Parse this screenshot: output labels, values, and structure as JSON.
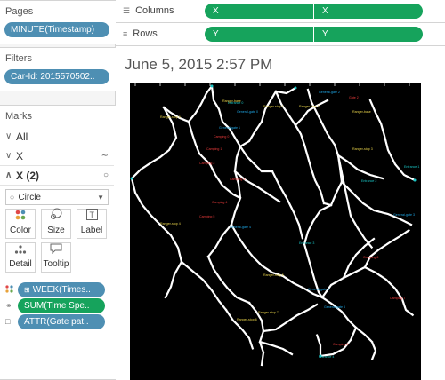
{
  "pages": {
    "title": "Pages",
    "pill": "MINUTE(Timestamp)"
  },
  "filters": {
    "title": "Filters",
    "pill": "Car-Id: 2015570502.."
  },
  "marks": {
    "title": "Marks",
    "all_label": "All",
    "x_label": "X",
    "x2_label": "X (2)",
    "mark_type": "Circle",
    "buttons": {
      "color": "Color",
      "size": "Size",
      "label": "Label",
      "detail": "Detail",
      "tooltip": "Tooltip"
    },
    "fields": [
      "WEEK(Times..",
      "SUM(Time Spe..",
      "ATTR(Gate pat.."
    ]
  },
  "columns": {
    "label": "Columns",
    "pills": [
      "X",
      "X"
    ]
  },
  "rows": {
    "label": "Rows",
    "pills": [
      "Y",
      "Y"
    ]
  },
  "view": {
    "title": "June 5, 2015 2:57 PM"
  },
  "map_labels": [
    {
      "text": "Entrance 0",
      "color": "#19c6c6"
    },
    {
      "text": "General-gate 0",
      "color": "#1ea7e6"
    },
    {
      "text": "Ranger-stop 0",
      "color": "#e8d34a"
    },
    {
      "text": "Ranger-stop 1",
      "color": "#e8d34a"
    },
    {
      "text": "Ranger-stop 2",
      "color": "#e8d34a"
    },
    {
      "text": "General-gate 1",
      "color": "#1ea7e6"
    },
    {
      "text": "General-gate 2",
      "color": "#1ea7e6"
    },
    {
      "text": "Ranger-base",
      "color": "#e8d34a"
    },
    {
      "text": "Camping 0",
      "color": "#ee3b3b"
    },
    {
      "text": "Camping 1",
      "color": "#ee3b3b"
    },
    {
      "text": "Camping 2",
      "color": "#ee3b3b"
    },
    {
      "text": "Camping 3",
      "color": "#ee3b3b"
    },
    {
      "text": "Camping 4",
      "color": "#ee3b3b"
    },
    {
      "text": "Camping 5",
      "color": "#ee3b3b"
    },
    {
      "text": "Entrance 1",
      "color": "#19c6c6"
    },
    {
      "text": "Ranger-stop 3",
      "color": "#e8d34a"
    },
    {
      "text": "General-gate 3",
      "color": "#1ea7e6"
    },
    {
      "text": "Gate 2",
      "color": "#ee3b3b"
    },
    {
      "text": "Entrance 2",
      "color": "#19c6c6"
    },
    {
      "text": "Ranger-stop 4",
      "color": "#e8d34a"
    },
    {
      "text": "General-gate 4",
      "color": "#1ea7e6"
    },
    {
      "text": "Entrance 3",
      "color": "#19c6c6"
    },
    {
      "text": "Camping 6",
      "color": "#ee3b3b"
    },
    {
      "text": "General-gate 5",
      "color": "#1ea7e6"
    },
    {
      "text": "Ranger-stop 5",
      "color": "#e8d34a"
    },
    {
      "text": "Camping 7",
      "color": "#ee3b3b"
    },
    {
      "text": "General-gate 6",
      "color": "#1ea7e6"
    },
    {
      "text": "Ranger-stop 6",
      "color": "#e8d34a"
    },
    {
      "text": "Ranger-stop 7",
      "color": "#e8d34a"
    },
    {
      "text": "Camping 8",
      "color": "#ee3b3b"
    },
    {
      "text": "Entrance 4",
      "color": "#19c6c6"
    },
    {
      "text": "Ranger-base",
      "color": "#e8d34a"
    }
  ]
}
